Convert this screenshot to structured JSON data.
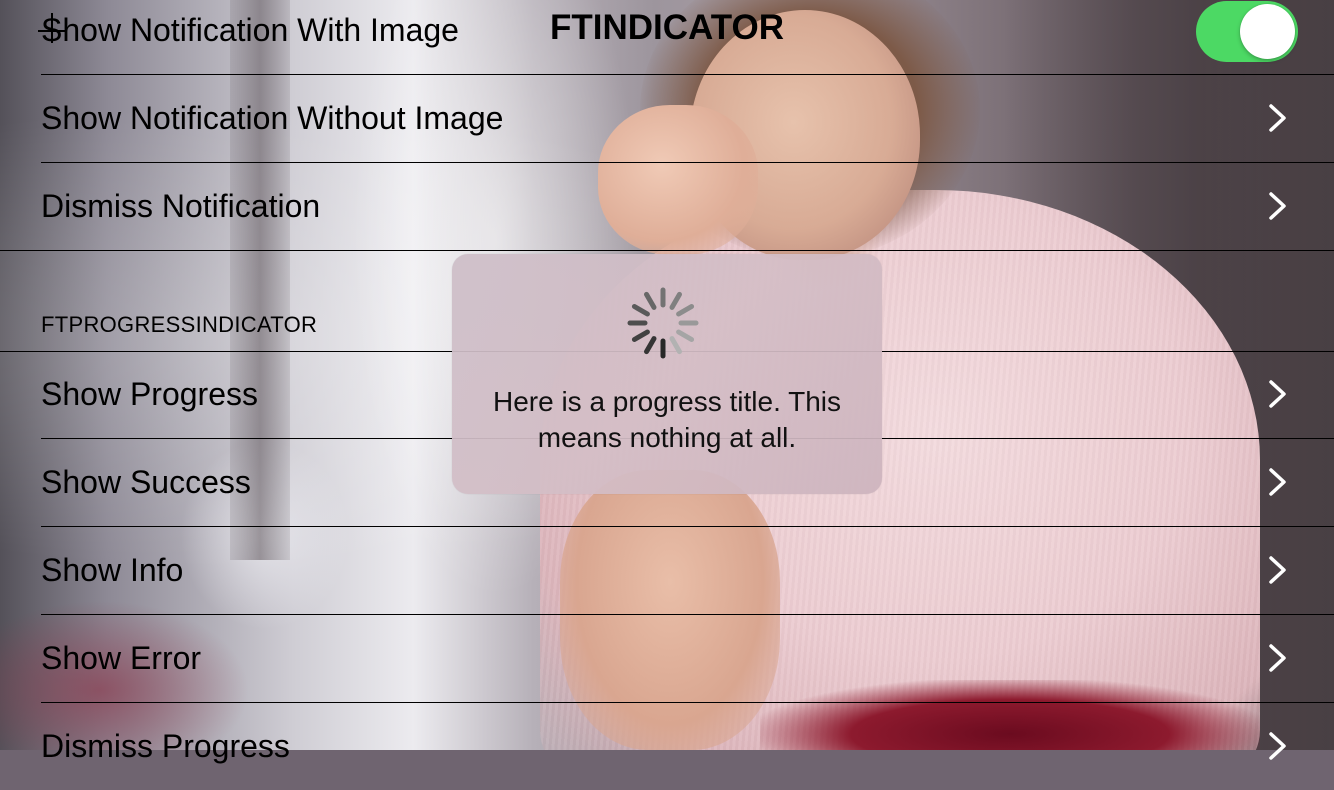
{
  "nav": {
    "title": "FTINDICATOR"
  },
  "notification_section": {
    "rows": [
      {
        "label": "Show Notification With Image",
        "accessory": "toggle",
        "toggle_on": true
      },
      {
        "label": "Show Notification Without Image",
        "accessory": "chevron-right-icon"
      },
      {
        "label": "Dismiss Notification",
        "accessory": "chevron-right-icon"
      }
    ]
  },
  "progress_section": {
    "header": "FTPROGRESSINDICATOR",
    "rows": [
      {
        "label": "Show Progress",
        "accessory": "chevron-right-icon"
      },
      {
        "label": "Show Success",
        "accessory": "chevron-right-icon"
      },
      {
        "label": "Show Info",
        "accessory": "chevron-right-icon"
      },
      {
        "label": "Show Error",
        "accessory": "chevron-right-icon"
      },
      {
        "label": "Dismiss Progress",
        "accessory": "chevron-right-icon"
      }
    ]
  },
  "progress_hud": {
    "icon": "activity-spinner-icon",
    "title": "Here is a progress title. This means nothing at all."
  },
  "colors": {
    "toggle_on": "#4cd964",
    "separator": "#000000",
    "chevron": "#ffffff"
  }
}
